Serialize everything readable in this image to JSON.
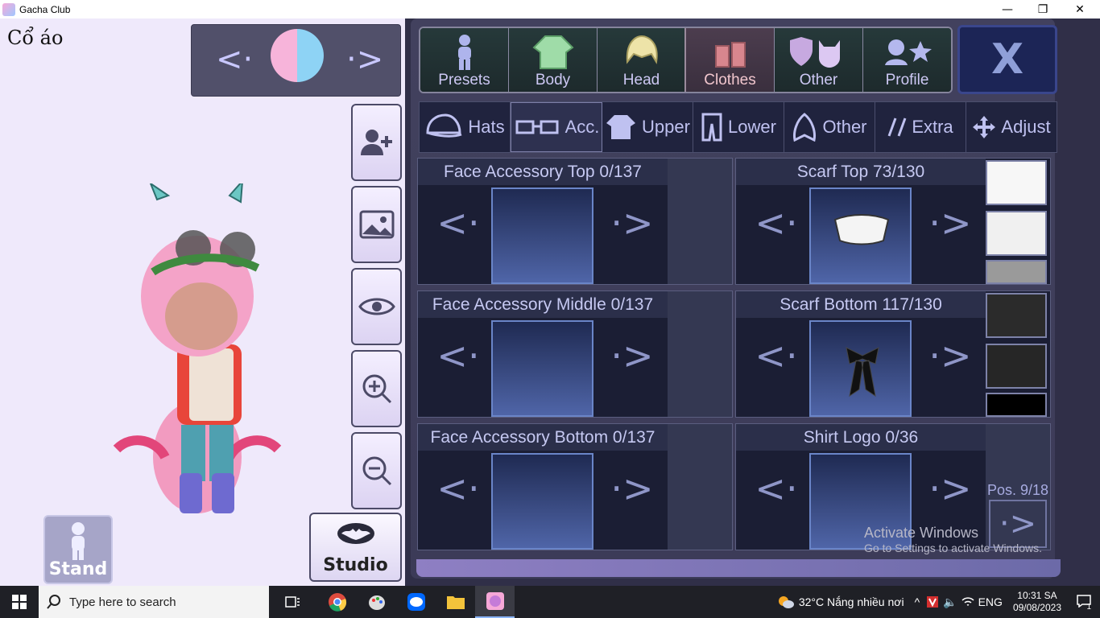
{
  "window": {
    "title": "Gacha Club",
    "min": "—",
    "restore": "❐",
    "close": "✕"
  },
  "stage": {
    "label": "Cổ áo",
    "char_prev": "<·",
    "char_next": "·>",
    "stand_label": "Stand",
    "studio_label": "Studio"
  },
  "tabs": [
    {
      "label": "Presets",
      "icon": "person-icon"
    },
    {
      "label": "Body",
      "icon": "jacket-icon"
    },
    {
      "label": "Head",
      "icon": "hair-icon"
    },
    {
      "label": "Clothes",
      "icon": "clothes-icon"
    },
    {
      "label": "Other",
      "icon": "shield-cat-icon"
    },
    {
      "label": "Profile",
      "icon": "profile-star-icon"
    }
  ],
  "close_label": "X",
  "subtabs": [
    {
      "label": "Hats"
    },
    {
      "label": "Acc."
    },
    {
      "label": "Upper"
    },
    {
      "label": "Lower"
    },
    {
      "label": "Other"
    },
    {
      "label": "Extra"
    },
    {
      "label": "Adjust"
    }
  ],
  "slots": [
    {
      "title": "Face Accessory Top 0/137"
    },
    {
      "title": "Scarf Top 73/130"
    },
    {
      "title": "Face Accessory Middle 0/137"
    },
    {
      "title": "Scarf Bottom 117/130"
    },
    {
      "title": "Face Accessory Bottom 0/137"
    },
    {
      "title": "Shirt Logo 0/36"
    }
  ],
  "slot_prev": "<·",
  "slot_next": "·>",
  "position": "Pos. 9/18",
  "watermark": {
    "line1": "Activate Windows",
    "line2": "Go to Settings to activate Windows."
  },
  "taskbar": {
    "search_placeholder": "Type here to search",
    "weather": "32°C  Nắng nhiều nơi",
    "lang": "ENG",
    "time": "10:31 SA",
    "date": "09/08/2023",
    "notifications": "1"
  },
  "colors": {
    "accent": "#6a85c8",
    "tab_active": "#4c3d4e",
    "panel": "#302f48"
  }
}
